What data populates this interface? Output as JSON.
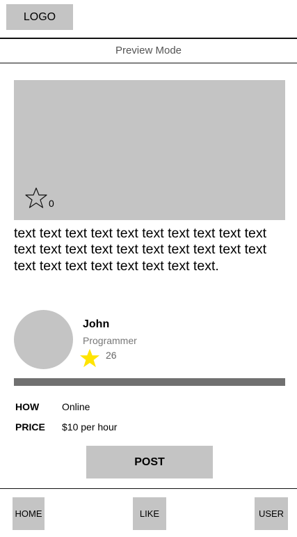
{
  "header": {
    "logo_label": "LOGO",
    "mode_label": "Preview Mode"
  },
  "media": {
    "favorite_icon": "star-outline-icon",
    "favorite_count": "0"
  },
  "description": "text text text text text text text text text text text text text text text text text text text text text text text text text text text text.",
  "profile": {
    "name": "John",
    "role": "Programmer",
    "rating_icon": "star-icon",
    "rating": "26",
    "rating_color": "#ffe400"
  },
  "progress": {
    "value": 1.0,
    "fill_color": "#707070"
  },
  "details": {
    "how_label": "HOW",
    "how_value": "Online",
    "price_label": "PRICE",
    "price_value": "$10 per hour"
  },
  "actions": {
    "post_label": "POST"
  },
  "nav": {
    "home_label": "HOME",
    "like_label": "LIKE",
    "user_label": "USER"
  },
  "colors": {
    "placeholder_gray": "#c4c4c4",
    "divider": "#111111"
  }
}
